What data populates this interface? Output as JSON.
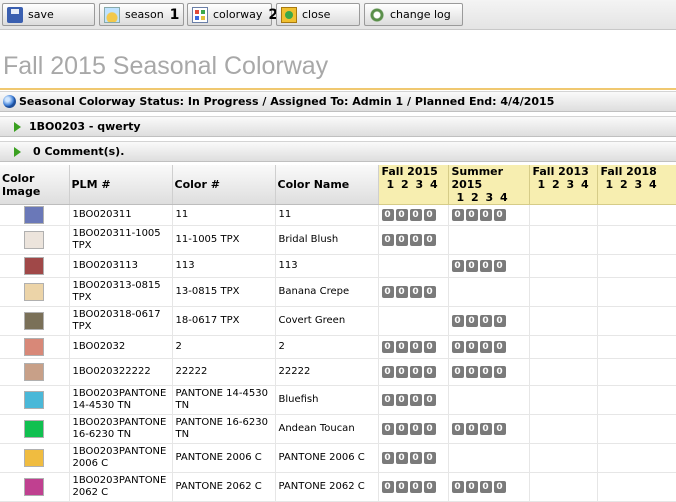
{
  "toolbar": {
    "save": {
      "label": "save",
      "icon": "save-icon"
    },
    "season": {
      "label": "season",
      "icon": "season-icon",
      "num": "1"
    },
    "colorway": {
      "label": "colorway",
      "icon": "colorway-icon",
      "num": "2"
    },
    "close": {
      "label": "close",
      "icon": "close-icon"
    },
    "changelog": {
      "label": "change log",
      "icon": "change-log-icon"
    }
  },
  "page": {
    "title": "Fall 2015 Seasonal Colorway"
  },
  "sections": {
    "status": "Seasonal Colorway  Status: In Progress / Assigned To: Admin 1 / Planned End: 4/4/2015",
    "product": "1BO0203 - qwerty",
    "comments": "0 Comment(s)."
  },
  "columns": {
    "color_image": "Color Image",
    "plm": "PLM #",
    "color_num": "Color #",
    "color_name": "Color Name"
  },
  "seasons": [
    {
      "name": "Fall 2015",
      "quarters": "1 2 3 4"
    },
    {
      "name": "Summer 2015",
      "quarters": "1 2 3 4"
    },
    {
      "name": "Fall 2013",
      "quarters": "1 2 3 4"
    },
    {
      "name": "Fall 2018",
      "quarters": "1 2 3 4"
    }
  ],
  "rows": [
    {
      "swatch": "#6a78b8",
      "plm": "1BO020311",
      "color_num": "11",
      "color_name": "11",
      "badges": [
        [
          "0",
          "0",
          "0",
          "0"
        ],
        [
          "0",
          "0",
          "0",
          "0"
        ],
        [],
        []
      ]
    },
    {
      "swatch": "#ece4dc",
      "plm": "1BO020311-1005 TPX",
      "color_num": "11-1005 TPX",
      "color_name": "Bridal Blush",
      "badges": [
        [
          "0",
          "0",
          "0",
          "0"
        ],
        [],
        [],
        []
      ]
    },
    {
      "swatch": "#a04848",
      "plm": "1BO0203113",
      "color_num": "113",
      "color_name": "113",
      "badges": [
        [],
        [
          "0",
          "0",
          "0",
          "0"
        ],
        [],
        []
      ]
    },
    {
      "swatch": "#ecd4a8",
      "plm": "1BO020313-0815 TPX",
      "color_num": "13-0815 TPX",
      "color_name": "Banana Crepe",
      "badges": [
        [
          "0",
          "0",
          "0",
          "0"
        ],
        [],
        [],
        []
      ]
    },
    {
      "swatch": "#7a7058",
      "plm": "1BO020318-0617 TPX",
      "color_num": "18-0617 TPX",
      "color_name": "Covert Green",
      "badges": [
        [],
        [
          "0",
          "0",
          "0",
          "0"
        ],
        [],
        []
      ]
    },
    {
      "swatch": "#d88878",
      "plm": "1BO02032",
      "color_num": "2",
      "color_name": "2",
      "badges": [
        [
          "0",
          "0",
          "0",
          "0"
        ],
        [
          "0",
          "0",
          "0",
          "0"
        ],
        [],
        []
      ]
    },
    {
      "swatch": "#c8a088",
      "plm": "1BO020322222",
      "color_num": "22222",
      "color_name": "22222",
      "badges": [
        [
          "0",
          "0",
          "0",
          "0"
        ],
        [
          "0",
          "0",
          "0",
          "0"
        ],
        [],
        []
      ]
    },
    {
      "swatch": "#4ab8d8",
      "plm": "1BO0203PANTONE 14-4530 TN",
      "color_num": "PANTONE 14-4530 TN",
      "color_name": "Bluefish",
      "badges": [
        [
          "0",
          "0",
          "0",
          "0"
        ],
        [],
        [],
        []
      ]
    },
    {
      "swatch": "#10c050",
      "plm": "1BO0203PANTONE 16-6230 TN",
      "color_num": "PANTONE 16-6230 TN",
      "color_name": "Andean Toucan",
      "badges": [
        [
          "0",
          "0",
          "0",
          "0"
        ],
        [
          "0",
          "0",
          "0",
          "0"
        ],
        [],
        []
      ]
    },
    {
      "swatch": "#f0bc40",
      "plm": "1BO0203PANTONE 2006 C",
      "color_num": "PANTONE 2006 C",
      "color_name": "PANTONE 2006 C",
      "badges": [
        [
          "0",
          "0",
          "0",
          "0"
        ],
        [],
        [],
        []
      ]
    },
    {
      "swatch": "#c04090",
      "plm": "1BO0203PANTONE 2062 C",
      "color_num": "PANTONE 2062 C",
      "color_name": "PANTONE 2062 C",
      "badges": [
        [
          "0",
          "0",
          "0",
          "0"
        ],
        [
          "0",
          "0",
          "0",
          "0"
        ],
        [],
        []
      ]
    }
  ]
}
